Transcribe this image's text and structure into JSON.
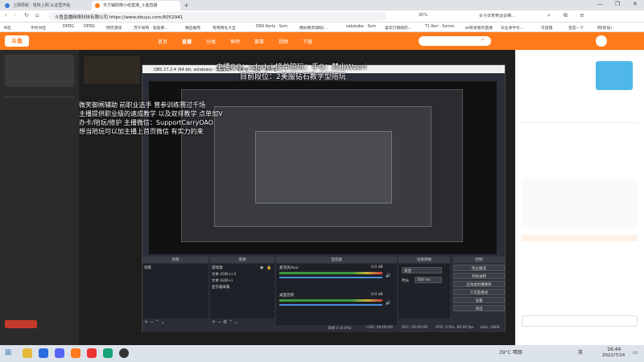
{
  "browser": {
    "tabs": [
      {
        "label": "上网导航 · 轻快上网 从这里开始",
        "favicon_color": "#3b7bd6"
      },
      {
        "label": "天才辅助微小组直播_斗鱼直播",
        "favicon_color": "#ff7a1a"
      }
    ],
    "url": "斗鱼直播网络科技有限公司  https://www.douyu.com/6052941",
    "zoom": "95%",
    "search_hint": "女子体育奥运会横...",
    "bookmarks": [
      "书签",
      "手机书签",
      "DPDG",
      "DPDG",
      "网页游戏",
      "苏宁易购 · 就是要...",
      "精品推荐",
      "有用网址大全",
      "DRX Kerla · Som",
      "模拟精灵辅助|...",
      "sakatabe · Som",
      "喜欢打辅助的...",
      "T1 Keri · Somm",
      "pr研发者的直播",
      "毕业季半价..."
    ],
    "bookmarks_right": [
      "可道理",
      "百度一下",
      "网(新站)"
    ]
  },
  "site": {
    "nav": [
      "首页",
      "直播",
      "分类",
      "鱼吧",
      "赛事",
      "视频",
      "下载"
    ]
  },
  "stream": {
    "banner_line1": "主播QQ：zdudei 接单陪玩：手Q：梵山Wzeri",
    "banner_line2": "目前段位：2美服钻石教学型陪玩",
    "overlay_line1": "微笑御闸辅助  前职业选手  曾参训练赛过千场",
    "overlay_line2": "主播提供职业级的速成教学 以及双排教学  点单加V",
    "overlay_line3": "办卡/陪玩/修护 主播微信：SupportCarryOAO",
    "overlay_line4": "想当陪玩可以加主播上首页微信 有实力的来"
  },
  "obs": {
    "title": "OBS 27.2.4 (64-bit, windows) - 配置文件：未命名 - 场景：未命名",
    "scenes_header": "场景",
    "sources_header": "来源",
    "mixer_header": "混音器",
    "transitions_header": "场景转换",
    "controls_header": "控制",
    "scene_item": "场景",
    "sources": [
      "游戏源",
      "文本 (GDI+) 2",
      "文本 (GDI+)",
      "显示器采集"
    ],
    "mixer_tracks": [
      "麦克风/Aux",
      "桌面音频"
    ],
    "mixer_db": [
      "0.0 dB",
      "0.0 dB"
    ],
    "transition_value": "渐变",
    "duration_label": "时长",
    "duration_value": "300 ms",
    "buttons": [
      "停止推流",
      "开始录制",
      "启动虚拟摄像机",
      "工作室模式",
      "设置",
      "退出"
    ],
    "status": {
      "drop": "丢帧 0 (0.0%)",
      "live": "LIVE: 00:00:00",
      "rec": "REC: 00:00:00",
      "cpu": "CPU: 0.9%, 60.00 fps",
      "kbps": "kb/s: 2806"
    }
  },
  "taskbar": {
    "weather": "39°C 晴朗",
    "lang": "英",
    "time": "16:44",
    "date": "2022/7/24"
  }
}
